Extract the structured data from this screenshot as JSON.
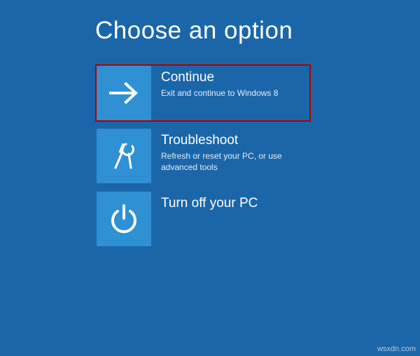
{
  "colors": {
    "background": "#1b66a9",
    "tile": "#2f90d4",
    "highlight_border": "#b00000",
    "text": "#ffffff"
  },
  "title": "Choose an option",
  "options": [
    {
      "icon": "arrow-right-icon",
      "title": "Continue",
      "description": "Exit and continue to Windows 8",
      "highlighted": true
    },
    {
      "icon": "tools-icon",
      "title": "Troubleshoot",
      "description": "Refresh or reset your PC, or use advanced tools",
      "highlighted": false
    },
    {
      "icon": "power-icon",
      "title": "Turn off your PC",
      "description": "",
      "highlighted": false
    }
  ],
  "watermark": "wsxdn.com"
}
